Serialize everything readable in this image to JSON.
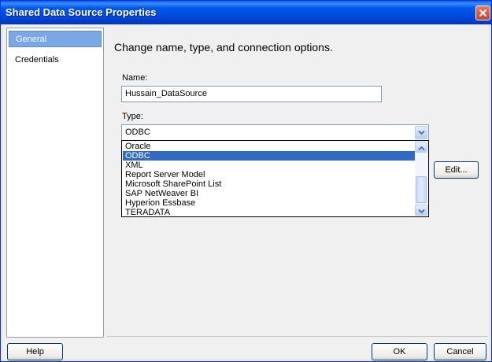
{
  "window": {
    "title": "Shared Data Source Properties"
  },
  "sidebar": {
    "items": [
      {
        "label": "General"
      },
      {
        "label": "Credentials"
      }
    ]
  },
  "main": {
    "heading": "Change name, type, and connection options.",
    "name_label": "Name:",
    "name_value": "Hussain_DataSource",
    "type_label": "Type:",
    "type_value": "ODBC",
    "type_options": [
      {
        "label": "Oracle"
      },
      {
        "label": "ODBC"
      },
      {
        "label": "XML"
      },
      {
        "label": "Report Server Model"
      },
      {
        "label": "Microsoft SharePoint List"
      },
      {
        "label": "SAP NetWeaver BI"
      },
      {
        "label": "Hyperion Essbase"
      },
      {
        "label": "TERADATA"
      }
    ],
    "selected_option": "ODBC",
    "edit_label": "Edit..."
  },
  "footer": {
    "help_label": "Help",
    "ok_label": "OK",
    "cancel_label": "Cancel"
  },
  "colors": {
    "titlebar": "#0058ee",
    "selection": "#316ac5",
    "sidebar_selection": "#7aa7e6"
  }
}
